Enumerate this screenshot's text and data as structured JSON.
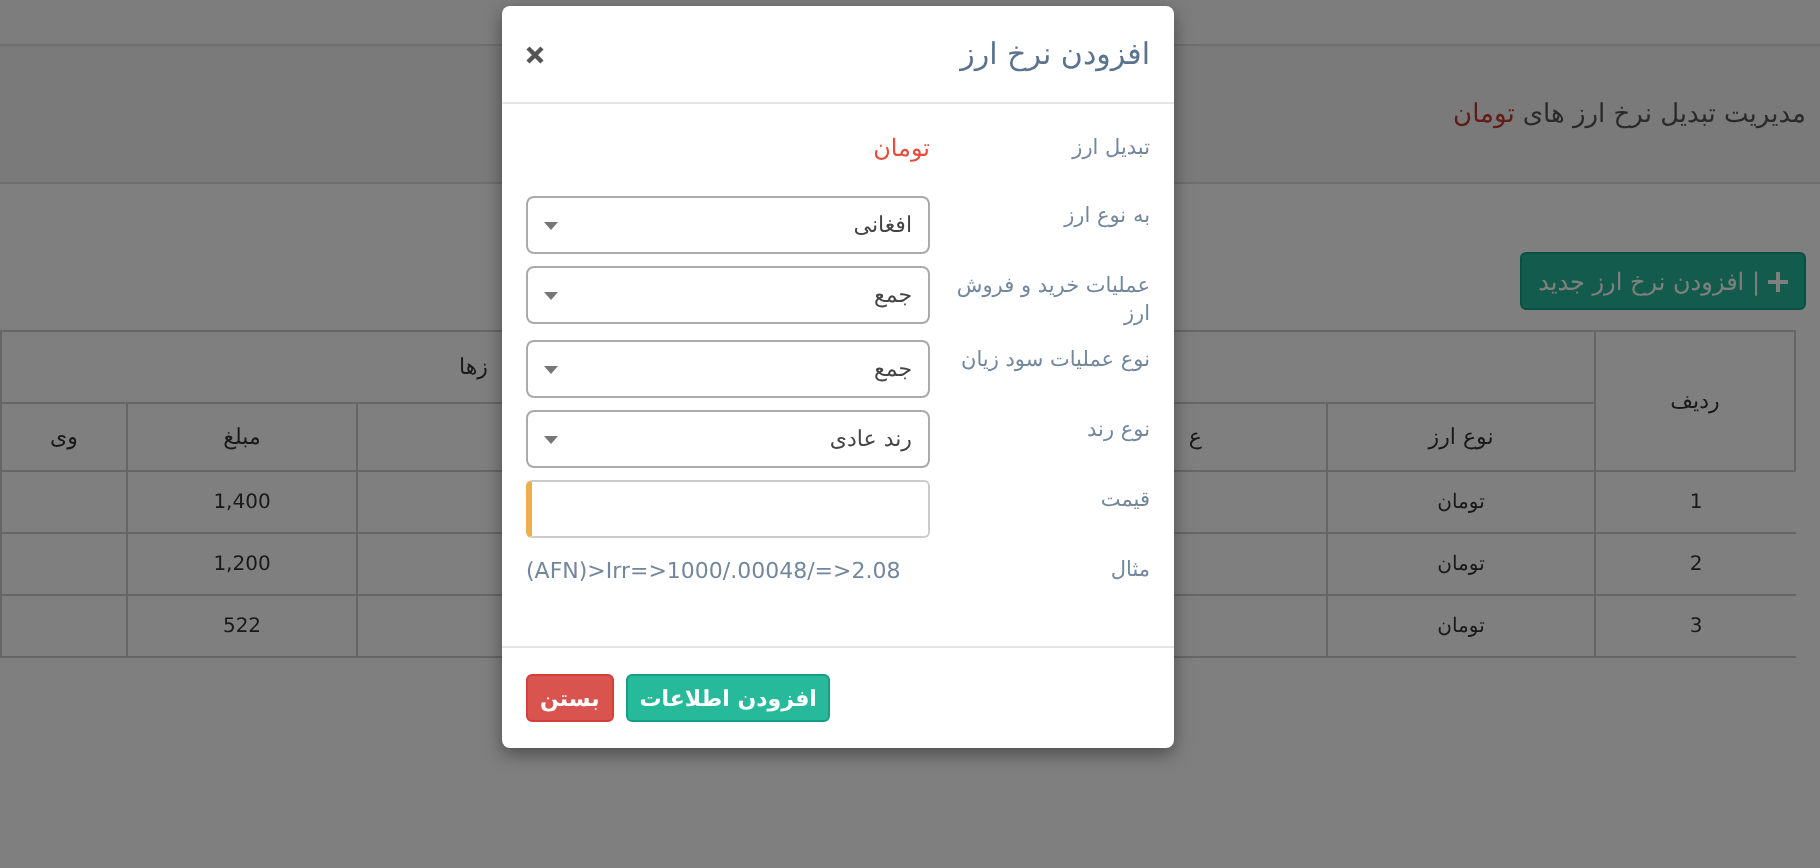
{
  "page": {
    "title": {
      "text": "مدیریت تبدیل نرخ ارز های",
      "highlight": "تومان"
    },
    "add_button": {
      "label": "| افزودن نرخ ارز جدید"
    },
    "table": {
      "group_header": "زها",
      "columns": {
        "index": "ردیف",
        "currency": "نوع ارز",
        "column_3": "ع",
        "amount": "مبلغ",
        "column_6": "وی"
      },
      "rows": [
        {
          "index": "1",
          "currency": "تومان",
          "amount": "1,400"
        },
        {
          "index": "2",
          "currency": "تومان",
          "amount": "1,200"
        },
        {
          "index": "3",
          "currency": "تومان",
          "amount": "522"
        }
      ]
    }
  },
  "modal": {
    "title": "افزودن نرخ ارز",
    "fields": [
      {
        "kind": "static",
        "label": "تبدیل ارز",
        "value": "تومان"
      },
      {
        "kind": "select",
        "label": "به نوع ارز",
        "value": "افغانی"
      },
      {
        "kind": "select",
        "label": "عملیات خرید و فروش ارز",
        "value": "جمع"
      },
      {
        "kind": "select",
        "label": "نوع عملیات سود زیان",
        "value": "جمع"
      },
      {
        "kind": "select",
        "label": "نوع رند",
        "value": "رند عادی"
      },
      {
        "kind": "input",
        "label": "قیمت",
        "focused": true
      },
      {
        "kind": "hint",
        "label": "مثال",
        "value": "(AFN)>Irr=>1000/.00048/=>2.08"
      }
    ],
    "buttons": [
      {
        "kind": "primary",
        "label": "افزودن اطلاعات"
      },
      {
        "kind": "danger",
        "label": "بستن"
      }
    ]
  }
}
